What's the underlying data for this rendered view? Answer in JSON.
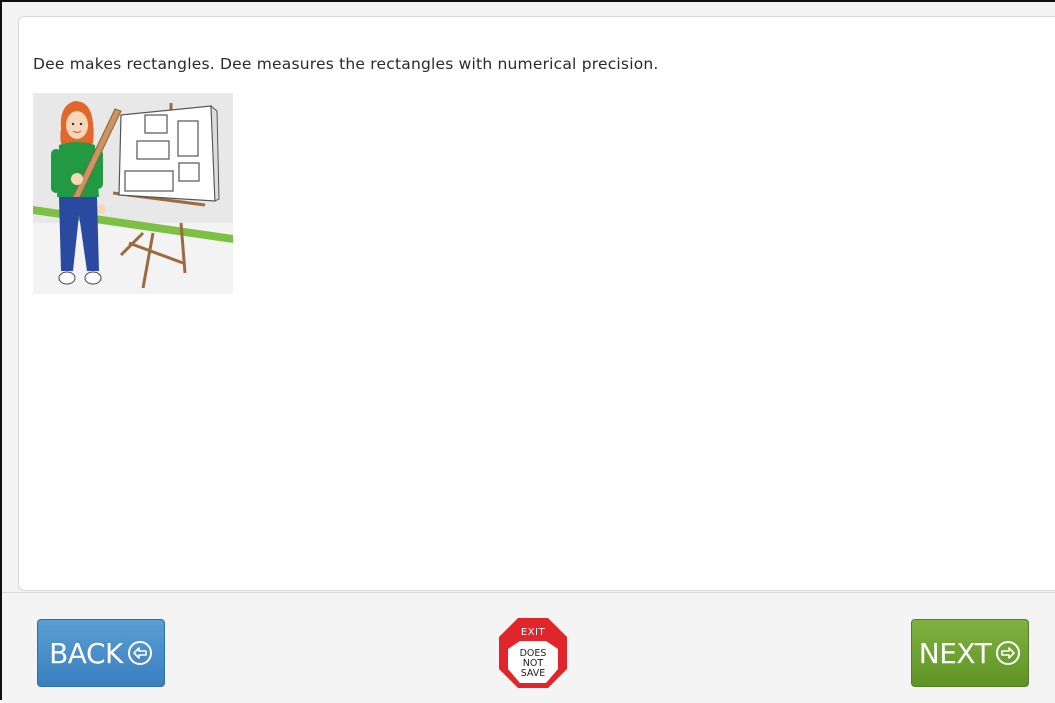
{
  "prompt": {
    "text": "Dee makes rectangles. Dee measures the rectangles with numerical precision."
  },
  "illustration": {
    "description_icon": "girl-with-ruler-and-easel-image"
  },
  "footer": {
    "back_label": "BACK",
    "next_label": "NEXT",
    "exit_top": "EXIT",
    "exit_line1": "DOES",
    "exit_line2": "NOT",
    "exit_line3": "SAVE"
  },
  "colors": {
    "back": "#4a90cc",
    "next": "#6fa332",
    "exit_red": "#e0262b"
  }
}
